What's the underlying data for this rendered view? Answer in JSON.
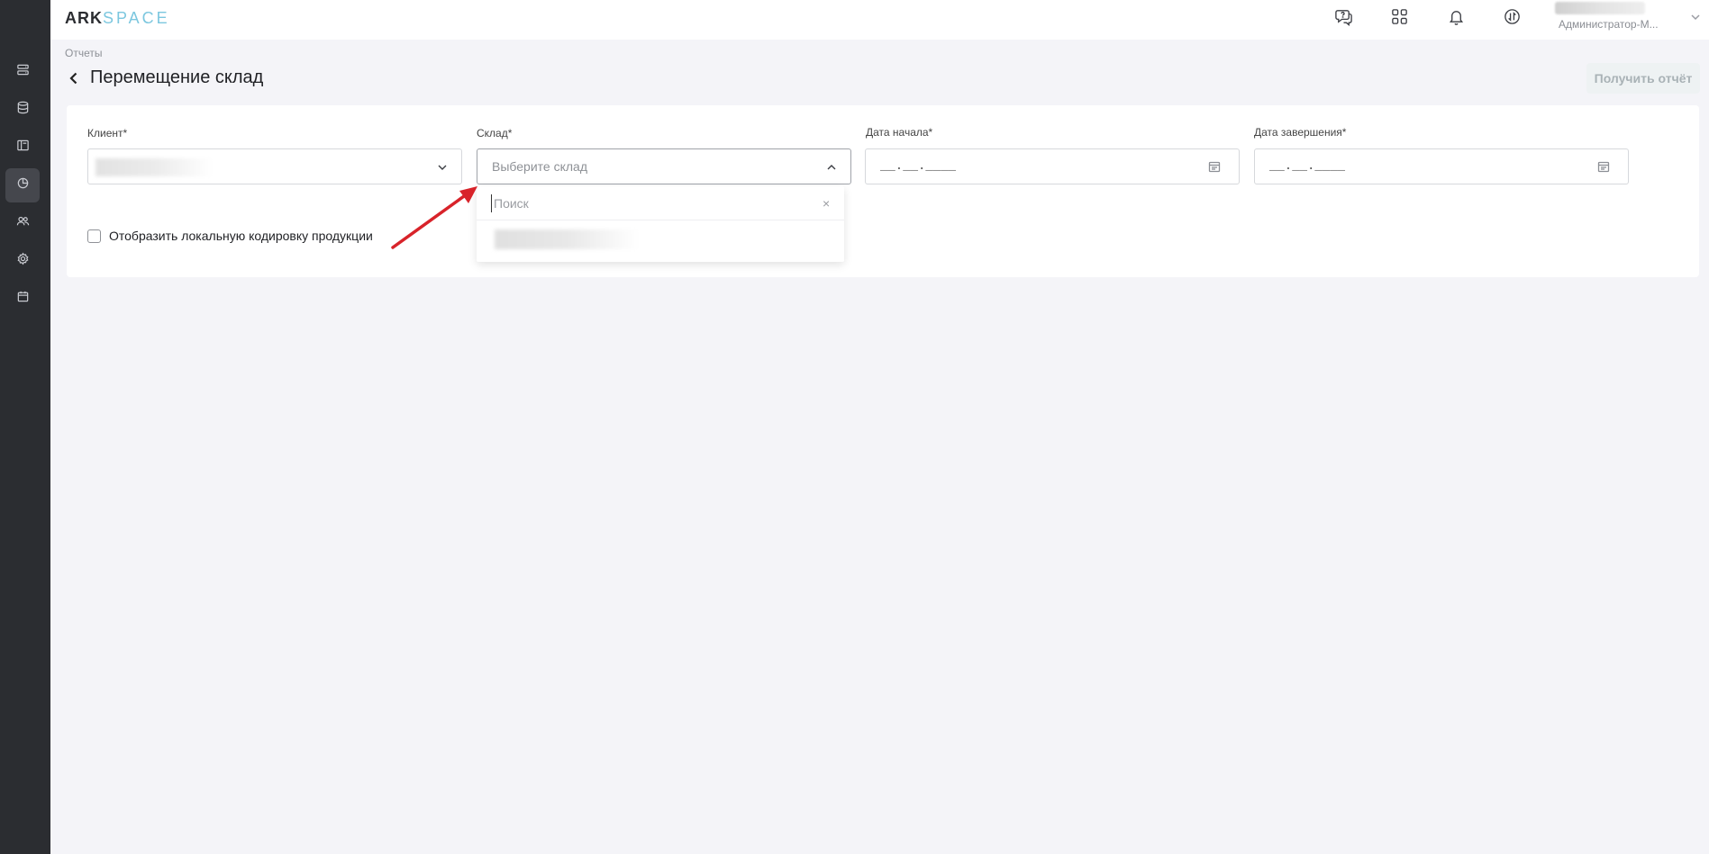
{
  "app": {
    "logo_ark": "ARK",
    "logo_space": "SPACE"
  },
  "sidebar": {
    "items": [
      {
        "icon": "server-icon",
        "active": false
      },
      {
        "icon": "database-icon",
        "active": false
      },
      {
        "icon": "layout-icon",
        "active": false
      },
      {
        "icon": "pie-chart-icon",
        "active": true
      },
      {
        "icon": "users-icon",
        "active": false
      },
      {
        "icon": "gear-icon",
        "active": false
      },
      {
        "icon": "calendar-icon",
        "active": false
      }
    ]
  },
  "topbar": {
    "icons": [
      "support-chat-icon",
      "apps-grid-icon",
      "bell-icon",
      "exchange-icon"
    ],
    "user_role": "Администратор-М..."
  },
  "breadcrumb": "Отчеты",
  "page_title": "Перемещение склад",
  "report_button": "Получить отчёт",
  "form": {
    "client_label": "Клиент*",
    "warehouse_label": "Склад*",
    "warehouse_placeholder": "Выберите склад",
    "start_date_label": "Дата начала*",
    "start_date_mask": "__.__.____",
    "end_date_label": "Дата завершения*",
    "end_date_mask": "__.__.____",
    "checkbox_label": "Отобразить локальную кодировку продукции",
    "checkbox_checked": false
  },
  "dropdown": {
    "search_placeholder": "Поиск",
    "clear_symbol": "×"
  },
  "colors": {
    "sidebar_bg": "#2b2d31",
    "accent_logo": "#7cc7df",
    "annotation_arrow": "#d8232a"
  }
}
